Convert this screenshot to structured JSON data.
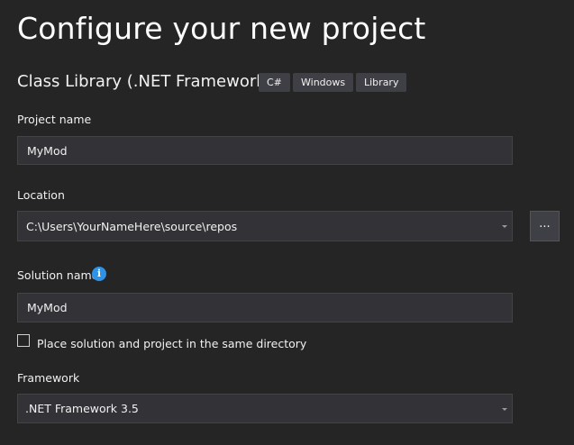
{
  "page": {
    "title": "Configure your new project"
  },
  "template": {
    "name": "Class Library (.NET Framework)",
    "tags": [
      "C#",
      "Windows",
      "Library"
    ]
  },
  "project_name": {
    "label": "Project name",
    "value": "MyMod"
  },
  "location": {
    "label": "Location",
    "value": "C:\\Users\\YourNameHere\\source\\repos",
    "browse_label": "..."
  },
  "solution_name": {
    "label": "Solution name",
    "info_icon": "i",
    "value": "MyMod"
  },
  "same_directory": {
    "label": "Place solution and project in the same directory",
    "checked": false
  },
  "framework": {
    "label": "Framework",
    "value": ".NET Framework 3.5"
  },
  "icons": {
    "info": "info-icon",
    "dropdown": "chevron-down-icon"
  },
  "colors": {
    "background": "#252526",
    "field_background": "#333337",
    "info_accent": "#2e93e6"
  }
}
